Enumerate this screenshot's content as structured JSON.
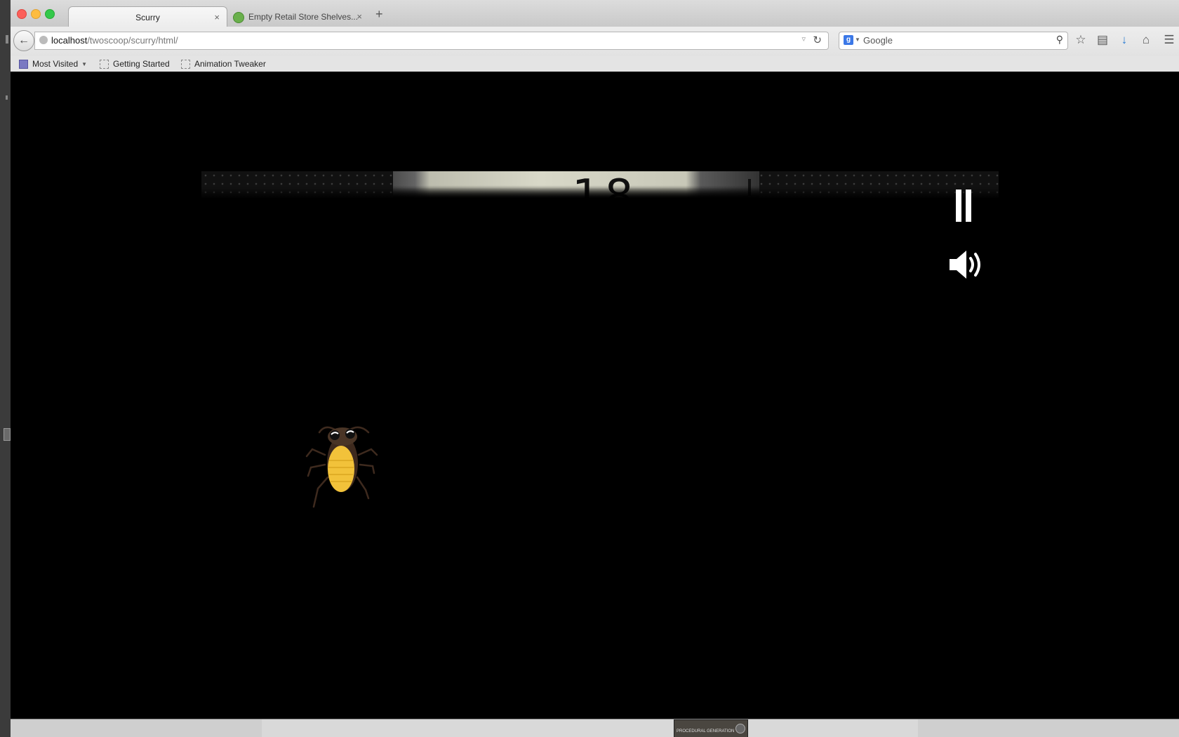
{
  "window": {
    "tabs": [
      {
        "title": "Scurry",
        "active": true
      },
      {
        "title": "Empty Retail Store Shelves...",
        "active": false
      }
    ],
    "new_tab_label": "+",
    "tab_close_glyph": "×"
  },
  "navbar": {
    "url_host": "localhost",
    "url_path": "/twoscoop/scurry/html/",
    "search_placeholder": "Google",
    "search_engine_letter": "g"
  },
  "bookmarks": [
    {
      "label": "Most Visited",
      "icon": "folder-icon"
    },
    {
      "label": "Getting Started",
      "icon": "page-icon"
    },
    {
      "label": "Animation Tweaker",
      "icon": "page-icon"
    }
  ],
  "game": {
    "score": "18",
    "pause_icon": "pause-icon",
    "sound_icon": "speaker-icon",
    "sprite": "cockroach"
  },
  "dock": {
    "thumbnail_text": "PROCEDURAL GENERATION"
  },
  "colors": {
    "game_background": "#000000",
    "cockroach_body": "#f2c23a",
    "cockroach_head": "#4a3526"
  }
}
